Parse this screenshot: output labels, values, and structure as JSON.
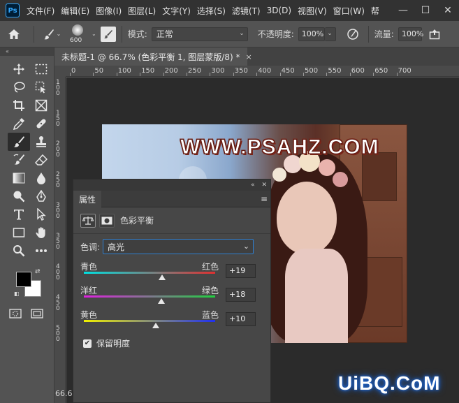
{
  "app": {
    "logo_text": "Ps",
    "menu": [
      "文件(F)",
      "编辑(E)",
      "图像(I)",
      "图层(L)",
      "文字(Y)",
      "选择(S)",
      "滤镜(T)",
      "3D(D)",
      "视图(V)",
      "窗口(W)",
      "帮"
    ],
    "window_controls": [
      "—",
      "☐",
      "✕"
    ]
  },
  "options_bar": {
    "brush_size": "600",
    "mode_label": "模式:",
    "mode_value": "正常",
    "opacity_label": "不透明度:",
    "opacity_value": "100%",
    "flow_label": "流量:",
    "flow_value": "100%"
  },
  "toolbar": {
    "collapse_label": "«",
    "foreground_color": "#000000",
    "background_color": "#ffffff"
  },
  "document": {
    "tab_title": "未标题-1 @ 66.7% (色彩平衡 1, 图层蒙版/8) *",
    "tab_close": "×",
    "zoom_readout": "66.6",
    "ruler_h": [
      "0",
      "50",
      "100",
      "150",
      "200",
      "250",
      "300",
      "350",
      "400",
      "450",
      "500",
      "550",
      "600",
      "650",
      "700"
    ],
    "ruler_v": [
      "1 0 0",
      "1 5 0",
      "2 0 0",
      "2 5 0",
      "3 0 0",
      "3 5 0",
      "4 0 0",
      "4 5 0",
      "5 0 0"
    ],
    "image_text": "WWW.PSAHZ.COM"
  },
  "properties_panel": {
    "topbar_collapse": "«",
    "topbar_close": "✕",
    "tab_label": "属性",
    "menu_icon": "≡",
    "header_title": "色彩平衡",
    "tone_label": "色调:",
    "tone_value": "高光",
    "sliders": [
      {
        "left_label": "青色",
        "right_label": "红色",
        "value": "+19",
        "numeric": 19
      },
      {
        "left_label": "洋红",
        "right_label": "绿色",
        "value": "+18",
        "numeric": 18
      },
      {
        "left_label": "黄色",
        "right_label": "蓝色",
        "value": "+10",
        "numeric": 10
      }
    ],
    "preserve_label": "保留明度",
    "preserve_checked": true
  },
  "overlay": {
    "site_logo": "UiBQ.CoM"
  }
}
